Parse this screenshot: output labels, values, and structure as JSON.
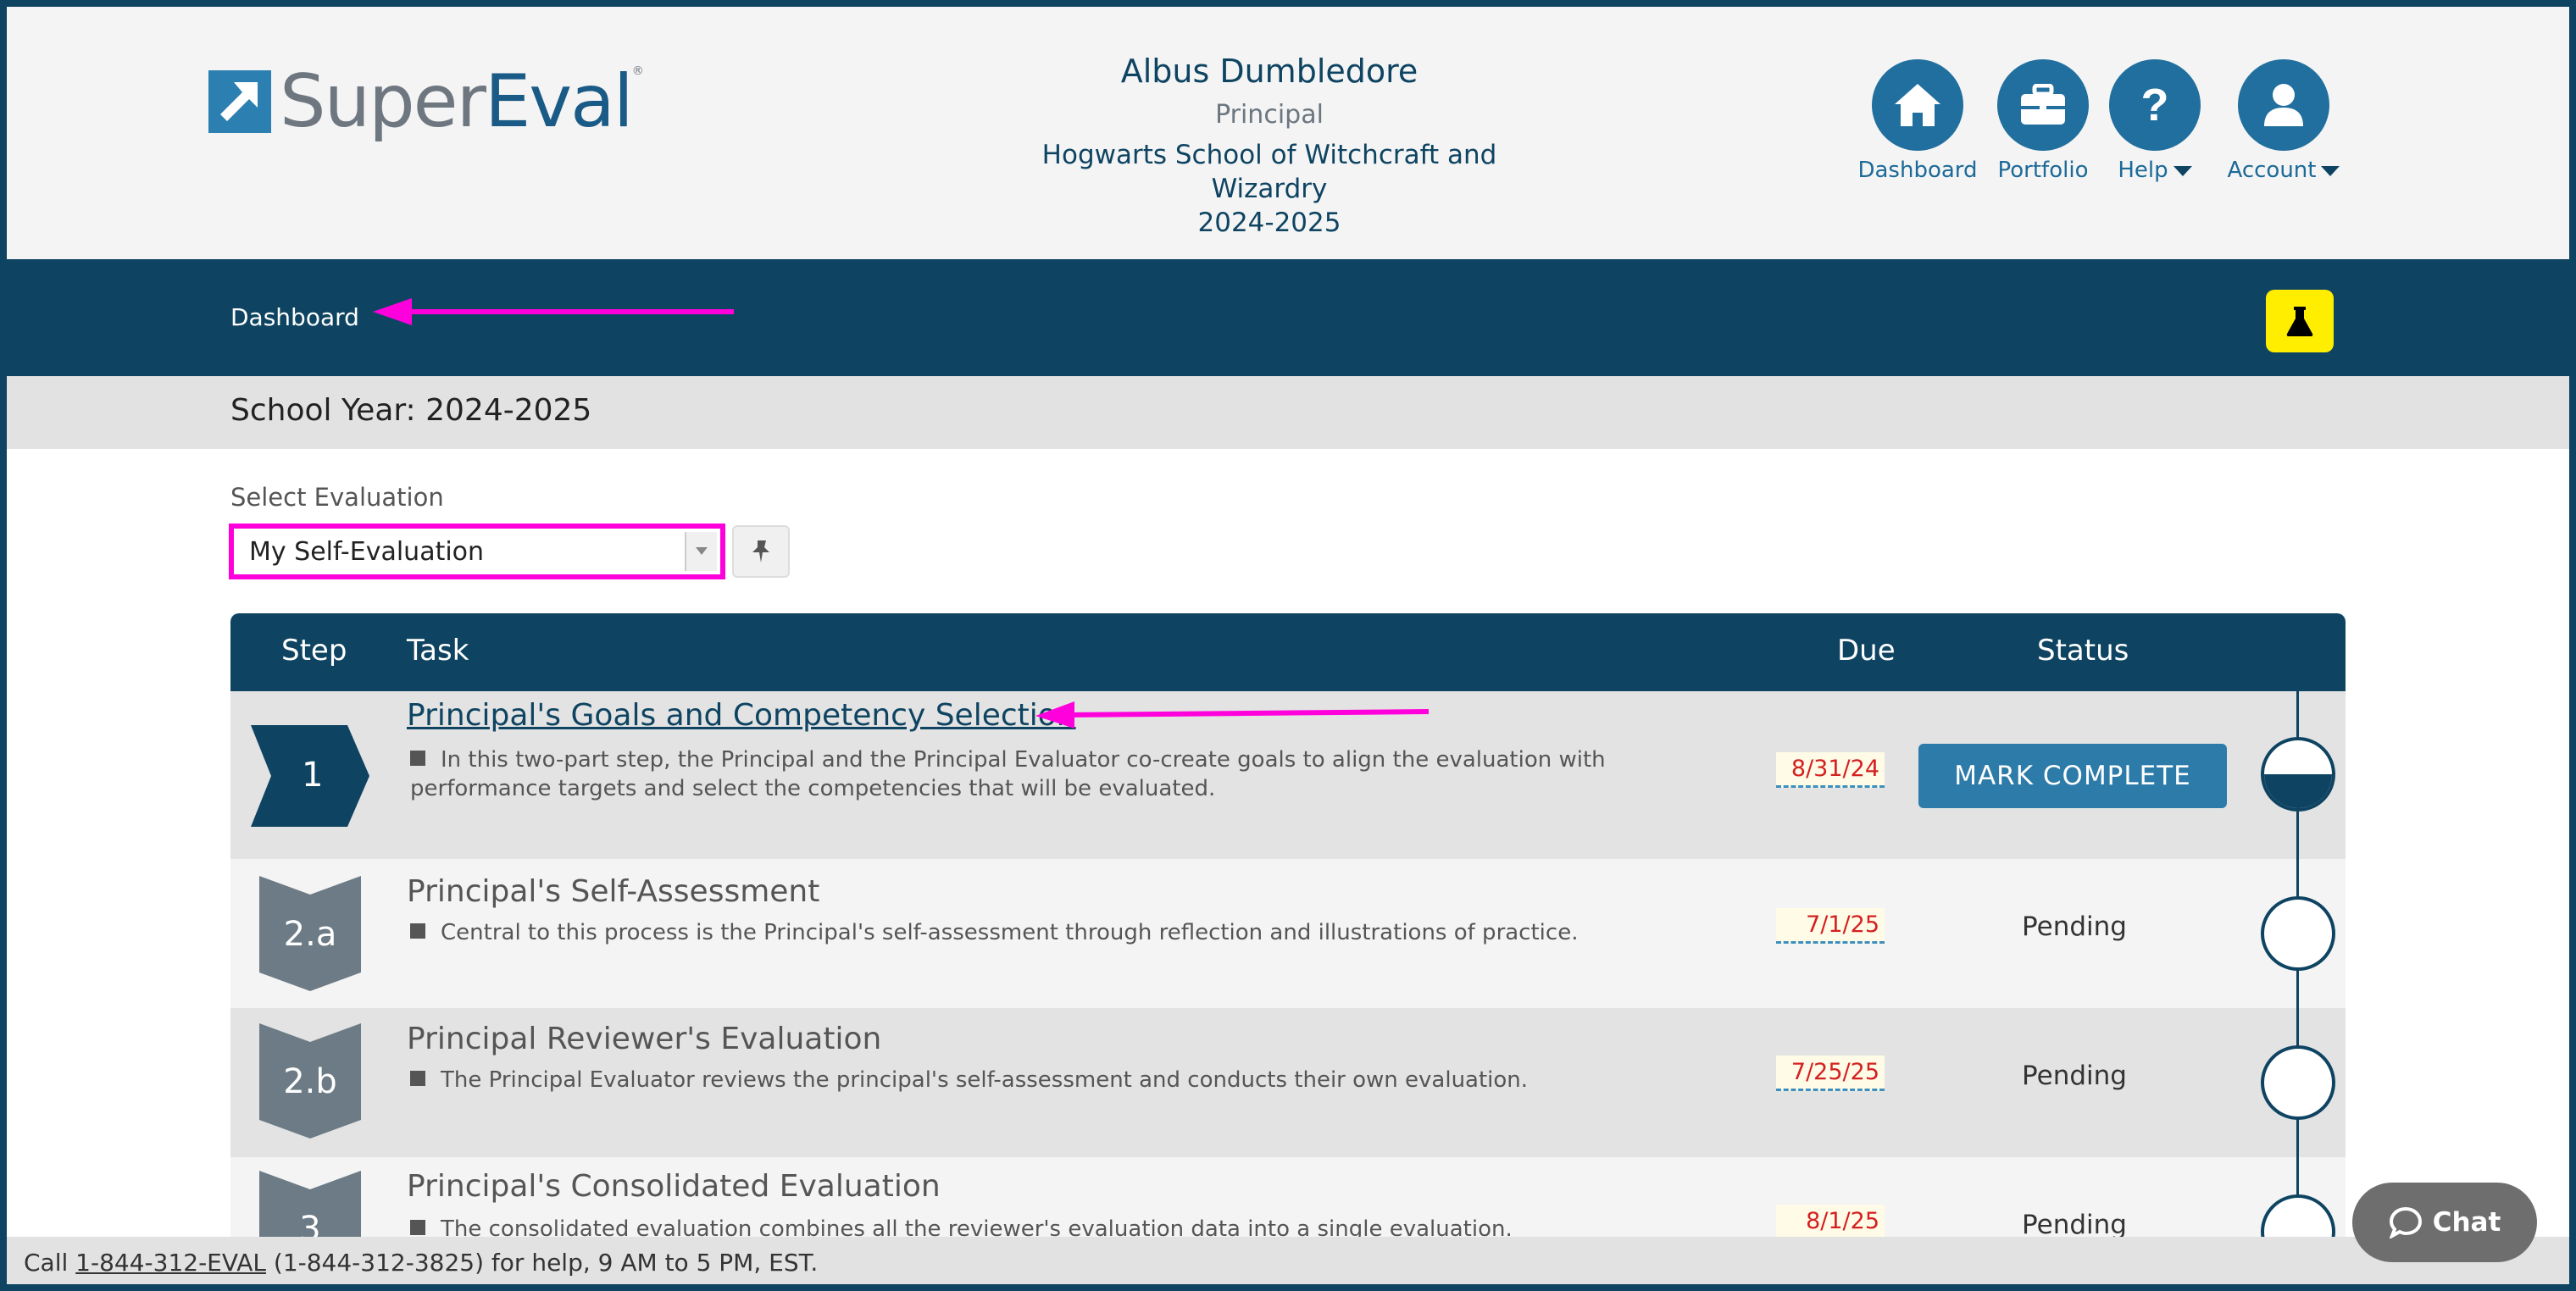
{
  "header": {
    "logo_super": "Super",
    "logo_eval": "Eval",
    "logo_mark": "®",
    "user_name": "Albus Dumbledore",
    "user_role": "Principal",
    "school_name": "Hogwarts School of Witchcraft and Wizardry",
    "school_year": "2024-2025",
    "nav": {
      "dashboard": "Dashboard",
      "portfolio": "Portfolio",
      "help": "Help",
      "account": "Account"
    }
  },
  "breadcrumb": {
    "current": "Dashboard"
  },
  "year_bar": {
    "text": "School Year: 2024-2025"
  },
  "select_evaluation": {
    "label": "Select Evaluation",
    "selected": "My Self-Evaluation"
  },
  "table": {
    "headers": {
      "step": "Step",
      "task": "Task",
      "due": "Due",
      "status": "Status"
    },
    "rows": [
      {
        "step": "1",
        "title": "Principal's Goals and Competency Selection",
        "desc": "In this two-part step, the Principal and the Principal Evaluator co-create goals to align the evaluation with performance targets and select the competencies that will be evaluated.",
        "due": "8/31/24",
        "action": "MARK COMPLETE",
        "progress": 0.5
      },
      {
        "step": "2.a",
        "title": "Principal's Self-Assessment",
        "desc": "Central to this process is the Principal's self-assessment through reflection and illustrations of practice.",
        "due": "7/1/25",
        "status": "Pending",
        "progress": 0
      },
      {
        "step": "2.b",
        "title": "Principal Reviewer's Evaluation",
        "desc": "The Principal Evaluator reviews the principal's self-assessment and conducts their own evaluation.",
        "due": "7/25/25",
        "status": "Pending",
        "progress": 0
      },
      {
        "step": "3",
        "title": "Principal's Consolidated Evaluation",
        "desc": "The consolidated evaluation combines all the reviewer's evaluation data into a single evaluation.",
        "due": "8/1/25",
        "status": "Pending",
        "progress": 0
      }
    ]
  },
  "footer": {
    "prefix": "Call ",
    "phone": "1-844-312-EVAL",
    "suffix": " (1-844-312-3825) for help, 9 AM to 5 PM, EST."
  },
  "chat": {
    "label": "Chat"
  },
  "colors": {
    "navy": "#0e4462",
    "accent_blue": "#2d7ba8",
    "annotation_magenta": "#ff00dd",
    "flask_yellow": "#ffee00",
    "due_red": "#d42020"
  }
}
